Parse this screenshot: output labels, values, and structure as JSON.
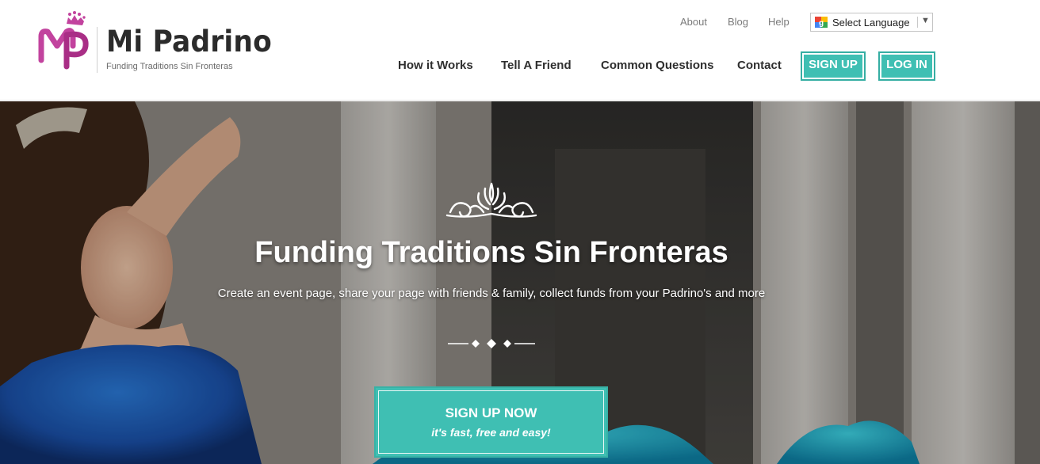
{
  "brand": {
    "name": "Mi Padrino",
    "tagline": "Funding Traditions Sin Fronteras",
    "logo_icon": "mp-crown-logo-icon",
    "primary_color": "#c2439e",
    "accent_color": "#3fbfb3"
  },
  "top_links": [
    {
      "label": "About"
    },
    {
      "label": "Blog"
    },
    {
      "label": "Help"
    }
  ],
  "language": {
    "label": "Select Language",
    "icon": "google-g-icon",
    "arrow": "▼"
  },
  "nav": [
    {
      "label": "How it Works"
    },
    {
      "label": "Tell A Friend"
    },
    {
      "label": "Common Questions"
    },
    {
      "label": "Contact"
    }
  ],
  "buttons": {
    "signup": "SIGN UP",
    "login": "LOG IN"
  },
  "hero": {
    "title": "Funding Traditions Sin Fronteras",
    "subtitle": "Create an event page, share your page with friends & family, collect funds from your Padrino's and more",
    "cta_main": "SIGN UP NOW",
    "cta_sub": "it's fast, free and easy!",
    "ornament_icon": "flourish-ornament-icon",
    "divider_icon": "diamond-divider-icon"
  }
}
